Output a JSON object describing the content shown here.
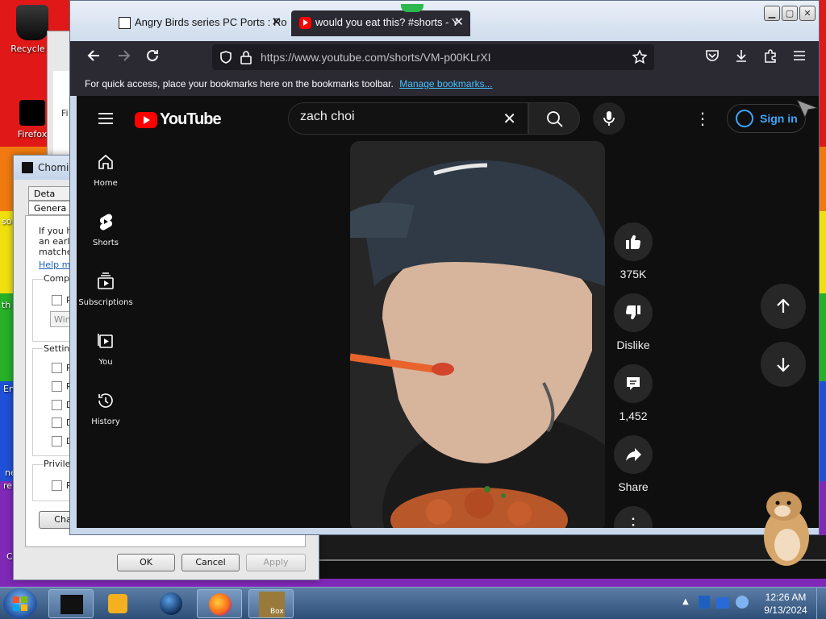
{
  "desktop": {
    "recycle_bin_label": "Recycle B",
    "firefox_label": "Firefox",
    "frag_fi": "Fi",
    "frag_so": "so",
    "frag_th": "th",
    "frag_en": "En",
    "frag_ne": "ne",
    "frag_re": "re",
    "frag_c": "C"
  },
  "dialog": {
    "title": "Chomi",
    "tab_details": "Deta",
    "tab_general": "Genera",
    "desc_line1": "If you ha",
    "desc_line2": "an earlie",
    "desc_line3": "matches",
    "help_link": "Help m",
    "compat_label": "Compa",
    "compat_r": "R",
    "compat_select": "Win",
    "settings_label": "Setting",
    "setting_items": [
      "R",
      "R",
      "D",
      "D",
      "D"
    ],
    "privilege_label": "Privileg",
    "privilege_r": "R",
    "change_label": "Cha",
    "ok_label": "OK",
    "cancel_label": "Cancel",
    "apply_label": "Apply"
  },
  "firefox": {
    "tabs": [
      {
        "label": "Angry Birds series PC Ports : Ro"
      },
      {
        "label": "would you eat this? #shorts - Y"
      }
    ],
    "url": "https://www.youtube.com/shorts/VM-p00KLrXI",
    "bookmarks_hint": "For quick access, place your bookmarks here on the bookmarks toolbar.",
    "manage_bookmarks_link": "Manage bookmarks..."
  },
  "youtube": {
    "logo_text": "YouTube",
    "search_value": "zach choi",
    "sign_in_label": "Sign in",
    "sidebar": [
      {
        "label": "Home",
        "icon": "home-icon"
      },
      {
        "label": "Shorts",
        "icon": "shorts-icon"
      },
      {
        "label": "Subscriptions",
        "icon": "subscriptions-icon"
      },
      {
        "label": "You",
        "icon": "you-icon"
      },
      {
        "label": "History",
        "icon": "history-icon"
      }
    ],
    "actions": {
      "like_count": "375K",
      "dislike_label": "Dislike",
      "comment_count": "1,452",
      "share_label": "Share"
    }
  },
  "taskbar": {
    "time": "12:26 AM",
    "date": "9/13/2024",
    "box_label": "Box"
  }
}
